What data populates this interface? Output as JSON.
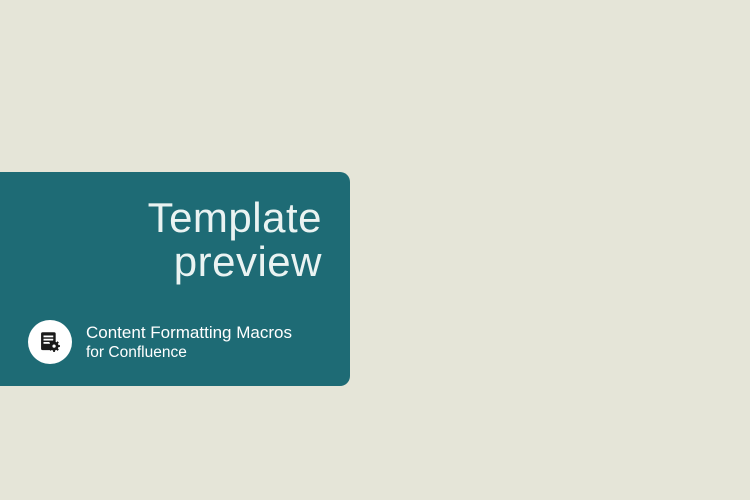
{
  "card": {
    "heading_line1": "Template",
    "heading_line2": "preview",
    "product_name": "Content Formatting Macros",
    "product_sub": "for Confluence"
  }
}
